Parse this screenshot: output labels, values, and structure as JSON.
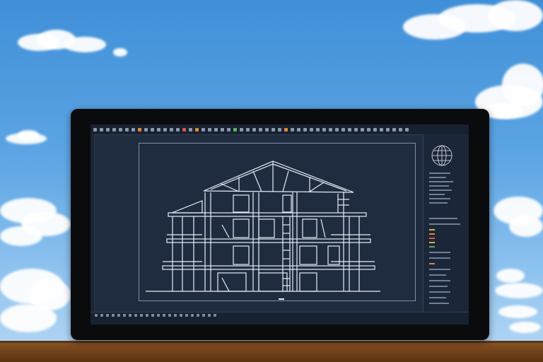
{
  "scene": {
    "subject": "tablet-showing-cad-app",
    "colors": {
      "sky_top": "#3f8fd8",
      "sky_bottom": "#b7d8f4",
      "desk": "#7a4820",
      "screen_bg": "#1f2c40",
      "linework": "#e6edf7"
    }
  },
  "cad_app": {
    "toolbar_icons": [
      "icon",
      "icon",
      "icon",
      "icon",
      "icon",
      "icon",
      "icon",
      "icon",
      "icon",
      "icon",
      "icon",
      "icon",
      "icon",
      "icon",
      "icon",
      "icon",
      "icon",
      "icon",
      "icon",
      "icon",
      "icon",
      "icon",
      "icon",
      "icon",
      "icon",
      "icon",
      "icon",
      "icon",
      "icon",
      "icon",
      "icon",
      "icon",
      "icon",
      "icon",
      "icon",
      "icon",
      "icon",
      "icon",
      "icon",
      "icon",
      "icon",
      "icon",
      "icon",
      "icon",
      "icon",
      "icon",
      "icon",
      "icon",
      "icon",
      "icon",
      "icon",
      "icon",
      "icon",
      "icon",
      "icon",
      "icon",
      "icon",
      "icon"
    ],
    "drawing": "building-section-elevation",
    "status_text": "",
    "panel_icon": "globe-icon"
  }
}
